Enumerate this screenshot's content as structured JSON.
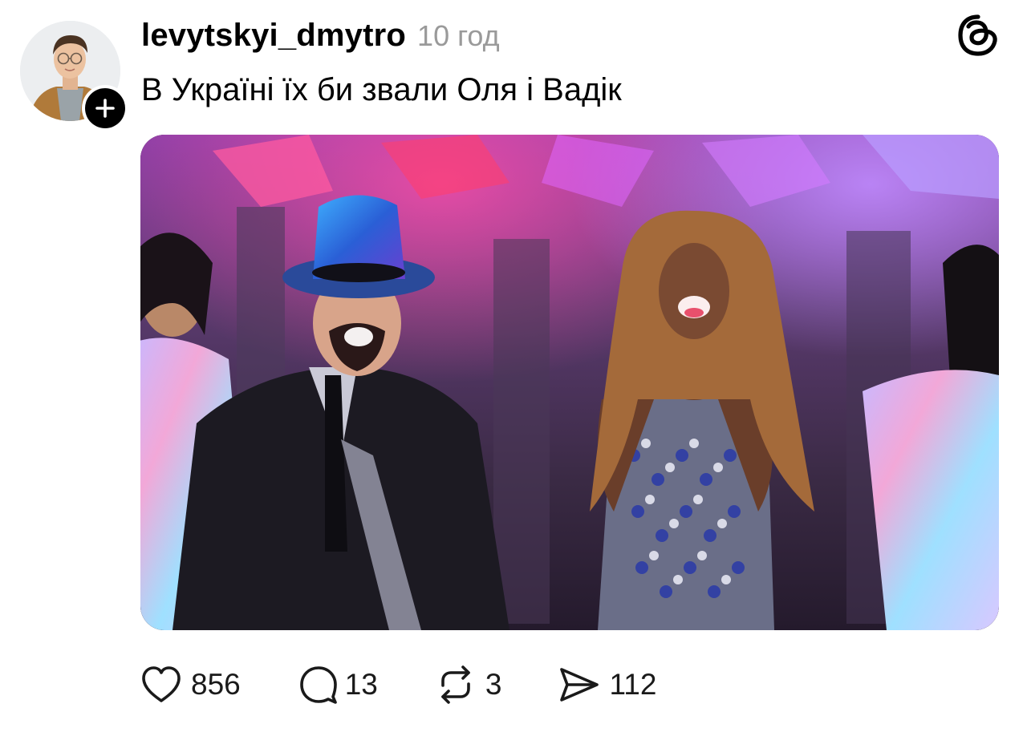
{
  "post": {
    "author": {
      "username": "levytskyi_dmytro",
      "avatar_icon": "profile-photo",
      "follow_icon": "plus-icon"
    },
    "timestamp": "10 год",
    "caption": "В Україні їх би звали Оля і Вадік",
    "app_logo_icon": "threads-logo-icon",
    "media": {
      "type": "photo",
      "content": "performers-on-stage-photo"
    },
    "actions": {
      "like": {
        "icon": "heart-icon",
        "count": "856"
      },
      "comment": {
        "icon": "comment-bubble-icon",
        "count": "13"
      },
      "repost": {
        "icon": "repost-icon",
        "count": "3"
      },
      "share": {
        "icon": "send-icon",
        "count": "112"
      }
    }
  },
  "colors": {
    "text_primary": "#000000",
    "text_secondary": "#9a9a9a",
    "background": "#ffffff"
  }
}
